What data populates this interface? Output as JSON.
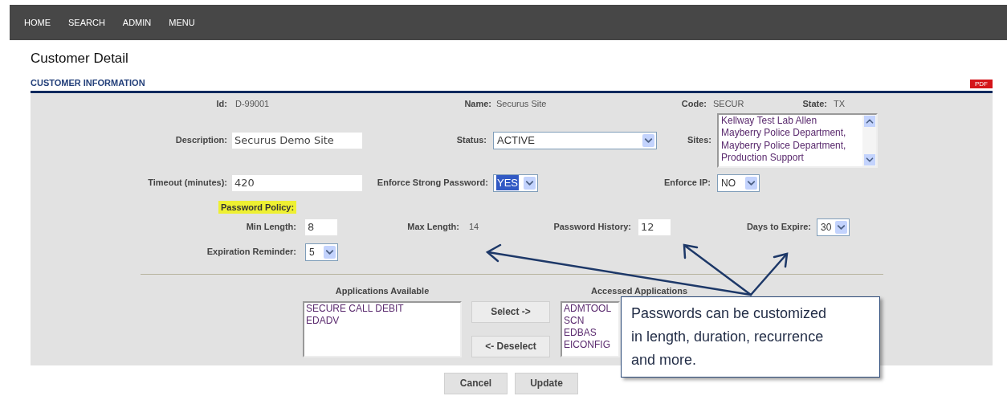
{
  "nav": [
    {
      "label": "HOME"
    },
    {
      "label": "SEARCH"
    },
    {
      "label": "ADMIN"
    },
    {
      "label": "MENU"
    }
  ],
  "page_title": "Customer Detail",
  "section_title": "CUSTOMER INFORMATION",
  "pdf_label": "PDF",
  "id": {
    "label": "Id:",
    "value": "D-99001"
  },
  "name": {
    "label": "Name:",
    "value": "Securus Site"
  },
  "code": {
    "label": "Code:",
    "value": "SECUR"
  },
  "state": {
    "label": "State:",
    "value": "TX"
  },
  "description": {
    "label": "Description:",
    "value": "Securus Demo Site"
  },
  "status": {
    "label": "Status:",
    "value": "ACTIVE"
  },
  "sites": {
    "label": "Sites:",
    "items": [
      "Kellway Test Lab Allen",
      "Mayberry Police Department, ",
      "Mayberry Police Department, ",
      "Production Support"
    ]
  },
  "timeout": {
    "label": "Timeout (minutes):",
    "value": "420"
  },
  "enforce_strong_password": {
    "label": "Enforce Strong Password:",
    "value": "YES",
    "focused": true
  },
  "enforce_ip": {
    "label": "Enforce IP:",
    "value": "NO",
    "focused": false
  },
  "password_policy": {
    "label": "Password Policy:",
    "highlighted": true
  },
  "min_length": {
    "label": "Min Length:",
    "value": "8"
  },
  "max_length": {
    "label": "Max Length:",
    "value": "14"
  },
  "password_history": {
    "label": "Password History:",
    "value": "12"
  },
  "days_to_expire": {
    "label": "Days to Expire:",
    "value": "30",
    "focused": false
  },
  "expiration_reminder": {
    "label": "Expiration Reminder:",
    "value": "5",
    "focused": false
  },
  "applications_available": {
    "heading": "Applications Available",
    "items": [
      "SECURE CALL DEBIT",
      "EDADV"
    ]
  },
  "select_button": "Select ->",
  "deselect_button": "<- Deselect",
  "accessed_applications": {
    "heading": "Accessed Applications",
    "items": [
      "ADMTOOL",
      "SCN",
      "EDBAS",
      "EICONFIG"
    ]
  },
  "actions": [
    "Cancel",
    "Update"
  ],
  "callout": {
    "text": "Passwords can be customized in length, duration, recurrence and more."
  }
}
